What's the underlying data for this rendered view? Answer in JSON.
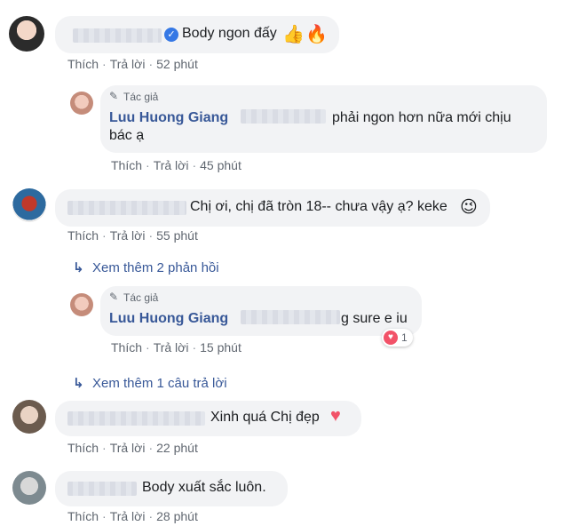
{
  "actions": {
    "like": "Thích",
    "reply": "Trả lời",
    "separator": "·"
  },
  "author_badge": "Tác giả",
  "comments": [
    {
      "text": "Body ngon đấy",
      "time": "52 phút"
    },
    {
      "author": "Luu Huong Giang",
      "text_line1": "phải ngon hơn nữa mới chịu",
      "text_line2": "bác ạ",
      "time": "45 phút"
    },
    {
      "text": "Chị ơi, chị đã tròn 18-- chưa vậy ạ? keke",
      "time": "55 phút"
    },
    {
      "more_replies": "Xem thêm 2 phản hồi"
    },
    {
      "author": "Luu Huong Giang",
      "text": "g sure e iu",
      "time": "15 phút",
      "reaction_count": "1"
    },
    {
      "more_replies": "Xem thêm 1 câu trả lời"
    },
    {
      "text": "Xinh quá Chị đẹp",
      "time": "22 phút"
    },
    {
      "text": "Body xuất sắc luôn.",
      "time": "28 phút"
    }
  ],
  "colors": {
    "name_blue": "#385898",
    "bubble": "#f2f3f5",
    "meta_gray": "#606770",
    "heart_red": "#f25268"
  }
}
